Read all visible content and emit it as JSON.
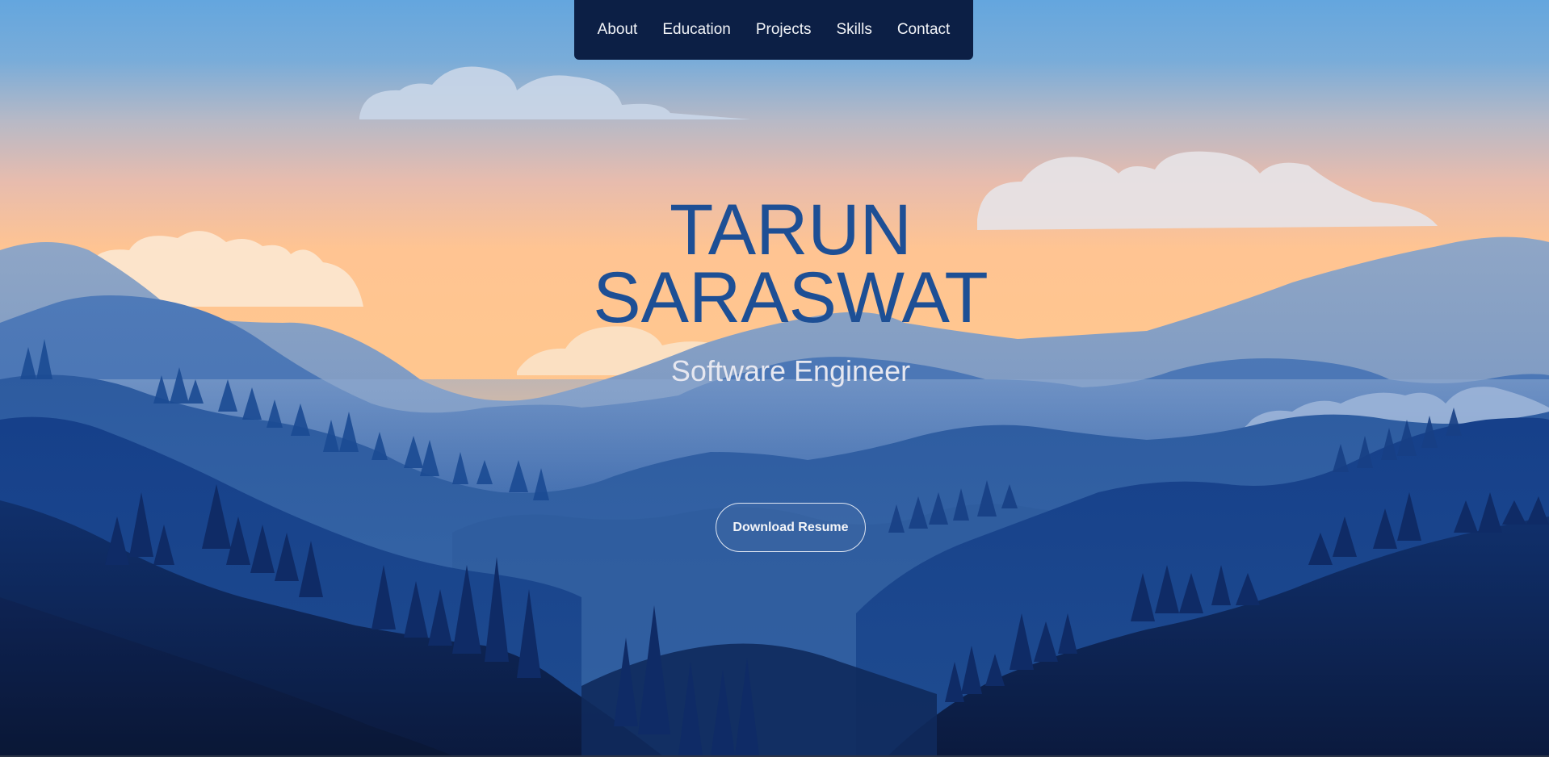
{
  "nav": {
    "items": [
      {
        "label": "About"
      },
      {
        "label": "Education"
      },
      {
        "label": "Projects"
      },
      {
        "label": "Skills"
      },
      {
        "label": "Contact"
      }
    ]
  },
  "hero": {
    "name_line1": "TARUN",
    "name_line2": "SARASWAT",
    "subtitle": "Software Engineer",
    "cta_label": "Download Resume"
  },
  "colors": {
    "nav_bg": "#0c1f45",
    "title": "#1d4f95",
    "sky_top": "#68a7de",
    "sky_glow": "#ffc48f",
    "mountain_dark": "#0b1a3e"
  }
}
